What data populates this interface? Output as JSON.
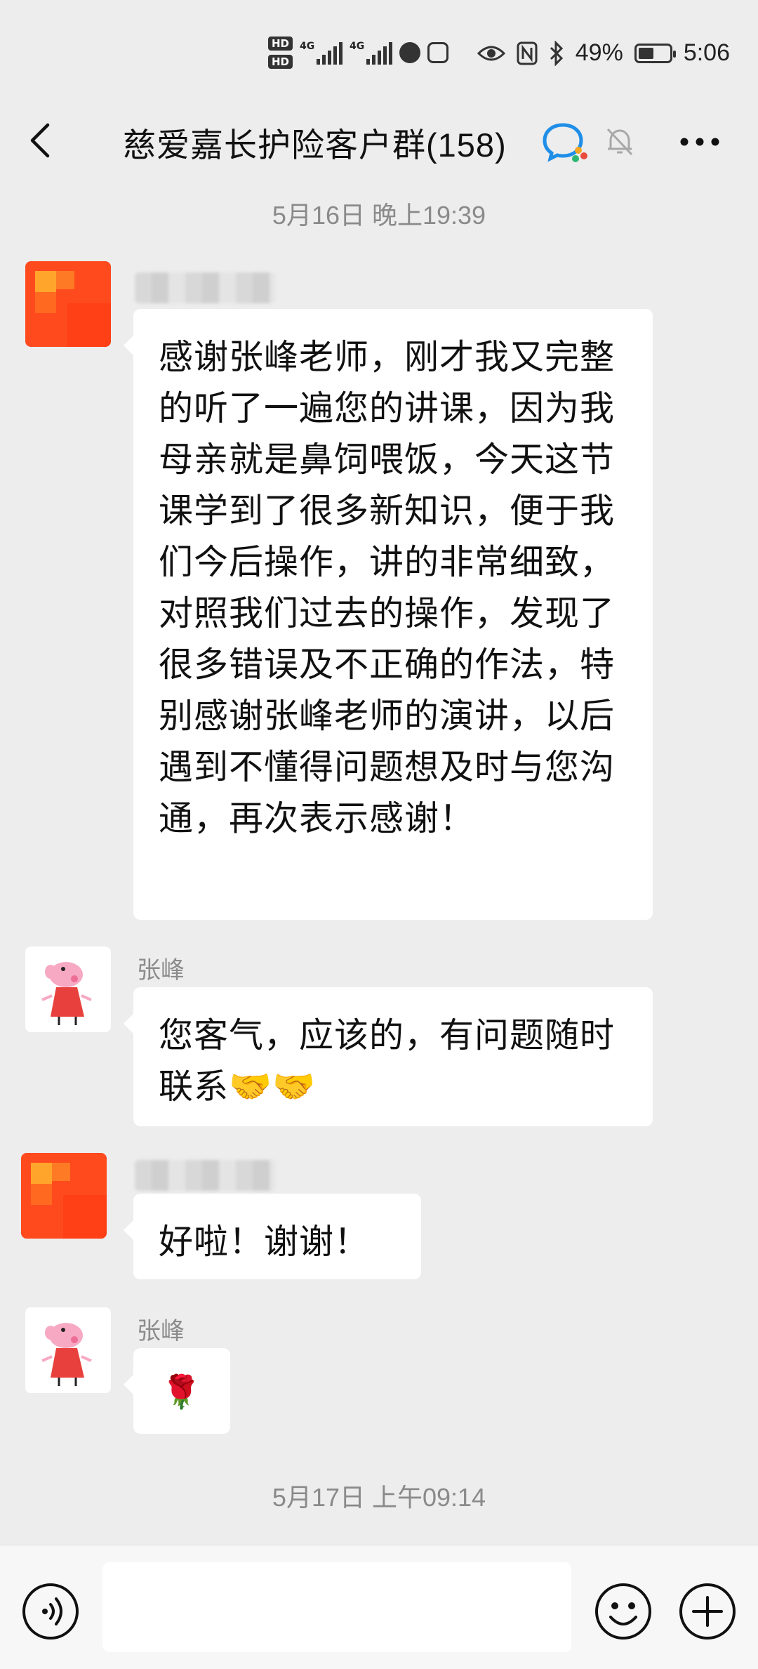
{
  "status_bar": {
    "hd1": "HD",
    "hd2": "HD",
    "net1": "4G",
    "net2": "4G",
    "battery": "49%",
    "time": "5:06",
    "battery_level": 0.49
  },
  "header": {
    "title": "慈爱嘉长护险客户群(158)"
  },
  "timestamps": {
    "first": "5月16日 晚上19:39",
    "second": "5月17日 上午09:14"
  },
  "messages": [
    {
      "sender": "",
      "text": "感谢张峰老师，刚才我又完整的听了一遍您的讲课，因为我母亲就是鼻饲喂饭，今天这节课学到了很多新知识，便于我们今后操作，讲的非常细致，对照我们过去的操作，发现了很多错误及不正确的作法，特别感谢张峰老师的演讲，以后遇到不懂得问题想及时与您沟通，再次表示感谢！"
    },
    {
      "sender": "张峰",
      "text": "您客气，应该的，有问题随时联系🤝🤝"
    },
    {
      "sender": "",
      "text": "好啦！谢谢！"
    },
    {
      "sender": "张峰",
      "text": "🌹"
    }
  ],
  "input": {
    "placeholder": ""
  },
  "icons": {
    "back": "back-arrow-icon",
    "chat_badge": "enterprise-chat-icon",
    "mute": "mute-bell-icon",
    "more": "more-icon",
    "voice": "voice-icon",
    "emoji": "emoji-icon",
    "plus": "plus-icon"
  }
}
